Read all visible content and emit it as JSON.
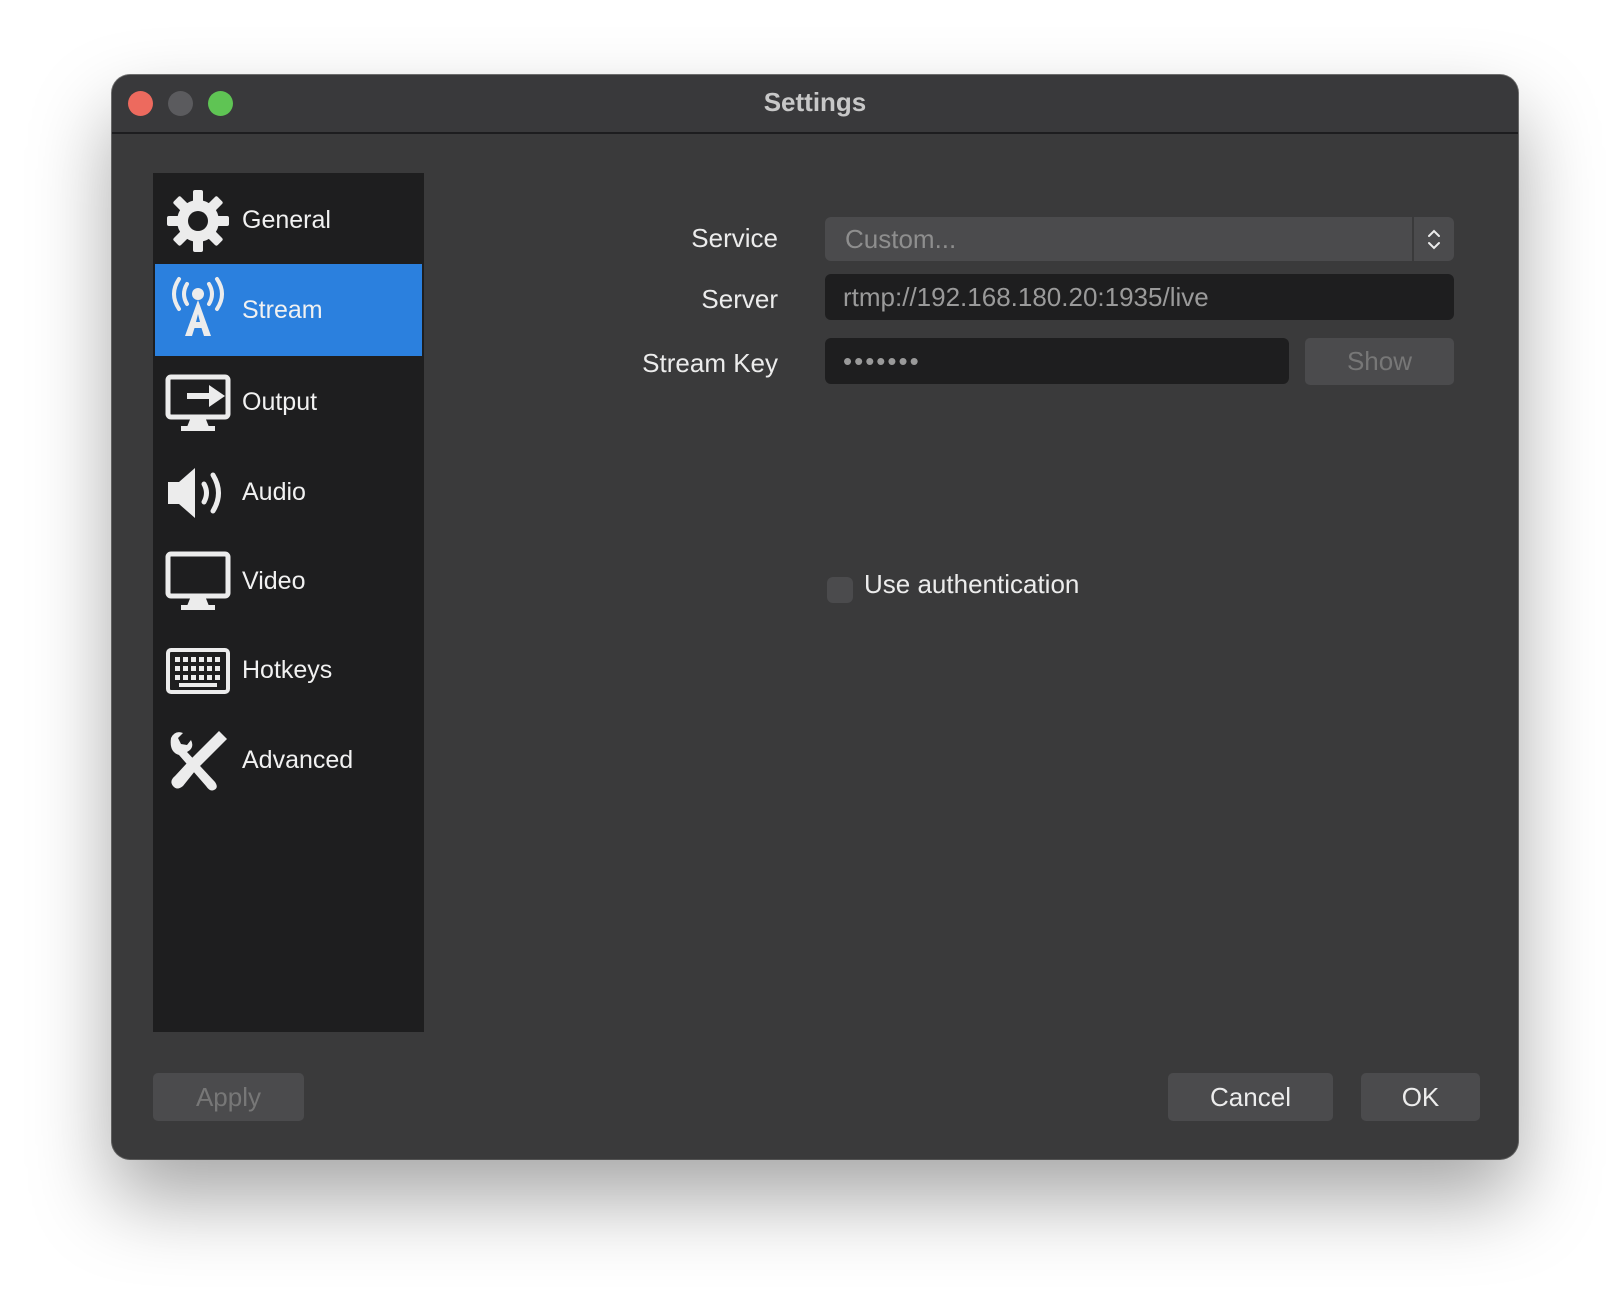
{
  "window": {
    "title": "Settings"
  },
  "sidebar": {
    "items": [
      {
        "label": "General",
        "icon": "gear-icon"
      },
      {
        "label": "Stream",
        "icon": "antenna-icon",
        "selected": true
      },
      {
        "label": "Output",
        "icon": "output-monitor-icon"
      },
      {
        "label": "Audio",
        "icon": "speaker-icon"
      },
      {
        "label": "Video",
        "icon": "monitor-icon"
      },
      {
        "label": "Hotkeys",
        "icon": "keyboard-icon"
      },
      {
        "label": "Advanced",
        "icon": "tools-icon"
      }
    ]
  },
  "stream": {
    "service_label": "Service",
    "service_value": "Custom...",
    "server_label": "Server",
    "server_value": "rtmp://192.168.180.20:1935/live",
    "stream_key_label": "Stream Key",
    "stream_key_value": "•••••••",
    "show_label": "Show",
    "use_auth_label": "Use authentication",
    "use_auth_checked": false
  },
  "footer": {
    "apply_label": "Apply",
    "cancel_label": "Cancel",
    "ok_label": "OK"
  },
  "colors": {
    "accent": "#2b80de",
    "close": "#ed6a5e",
    "zoom": "#5fc454"
  }
}
